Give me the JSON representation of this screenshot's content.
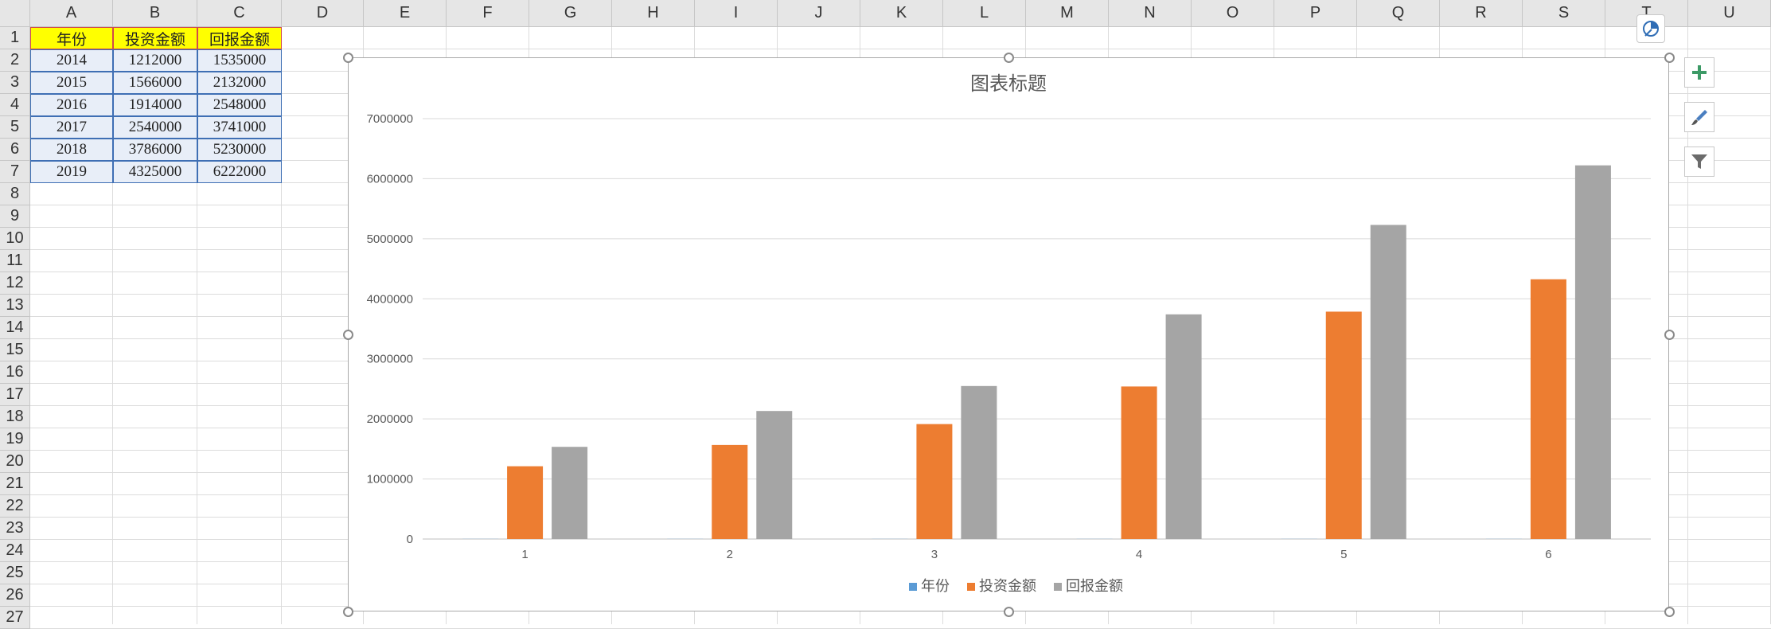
{
  "columns": [
    "A",
    "B",
    "C",
    "D",
    "E",
    "F",
    "G",
    "H",
    "I",
    "J",
    "K",
    "L",
    "M",
    "N",
    "O",
    "P",
    "Q",
    "R",
    "S",
    "T",
    "U"
  ],
  "rows": [
    "1",
    "2",
    "3",
    "4",
    "5",
    "6",
    "7",
    "8",
    "9",
    "10",
    "11",
    "12",
    "13",
    "14",
    "15",
    "16",
    "17",
    "18",
    "19",
    "20",
    "21",
    "22",
    "23",
    "24",
    "25",
    "26",
    "27"
  ],
  "table": {
    "headers": [
      "年份",
      "投资金额",
      "回报金额"
    ],
    "data": [
      [
        "2014",
        "1212000",
        "1535000"
      ],
      [
        "2015",
        "1566000",
        "2132000"
      ],
      [
        "2016",
        "1914000",
        "2548000"
      ],
      [
        "2017",
        "2540000",
        "3741000"
      ],
      [
        "2018",
        "3786000",
        "5230000"
      ],
      [
        "2019",
        "4325000",
        "6222000"
      ]
    ]
  },
  "colors": {
    "series_year": "#5b9bd5",
    "series_invest": "#ed7d31",
    "series_return": "#a5a5a5",
    "header_fill": "#ffff00"
  },
  "chart_data": {
    "type": "bar",
    "title": "图表标题",
    "categories": [
      "1",
      "2",
      "3",
      "4",
      "5",
      "6"
    ],
    "ylim": [
      0,
      7000000
    ],
    "yticks": [
      "0",
      "1000000",
      "2000000",
      "3000000",
      "4000000",
      "5000000",
      "6000000",
      "7000000"
    ],
    "grid": true,
    "legend_position": "bottom",
    "series": [
      {
        "name": "年份",
        "values": [
          2014,
          2015,
          2016,
          2017,
          2018,
          2019
        ]
      },
      {
        "name": "投资金额",
        "values": [
          1212000,
          1566000,
          1914000,
          2540000,
          3786000,
          4325000
        ]
      },
      {
        "name": "回报金额",
        "values": [
          1535000,
          2132000,
          2548000,
          3741000,
          5230000,
          6222000
        ]
      }
    ]
  },
  "side_buttons": [
    "plus-icon",
    "brush-icon",
    "filter-icon"
  ]
}
